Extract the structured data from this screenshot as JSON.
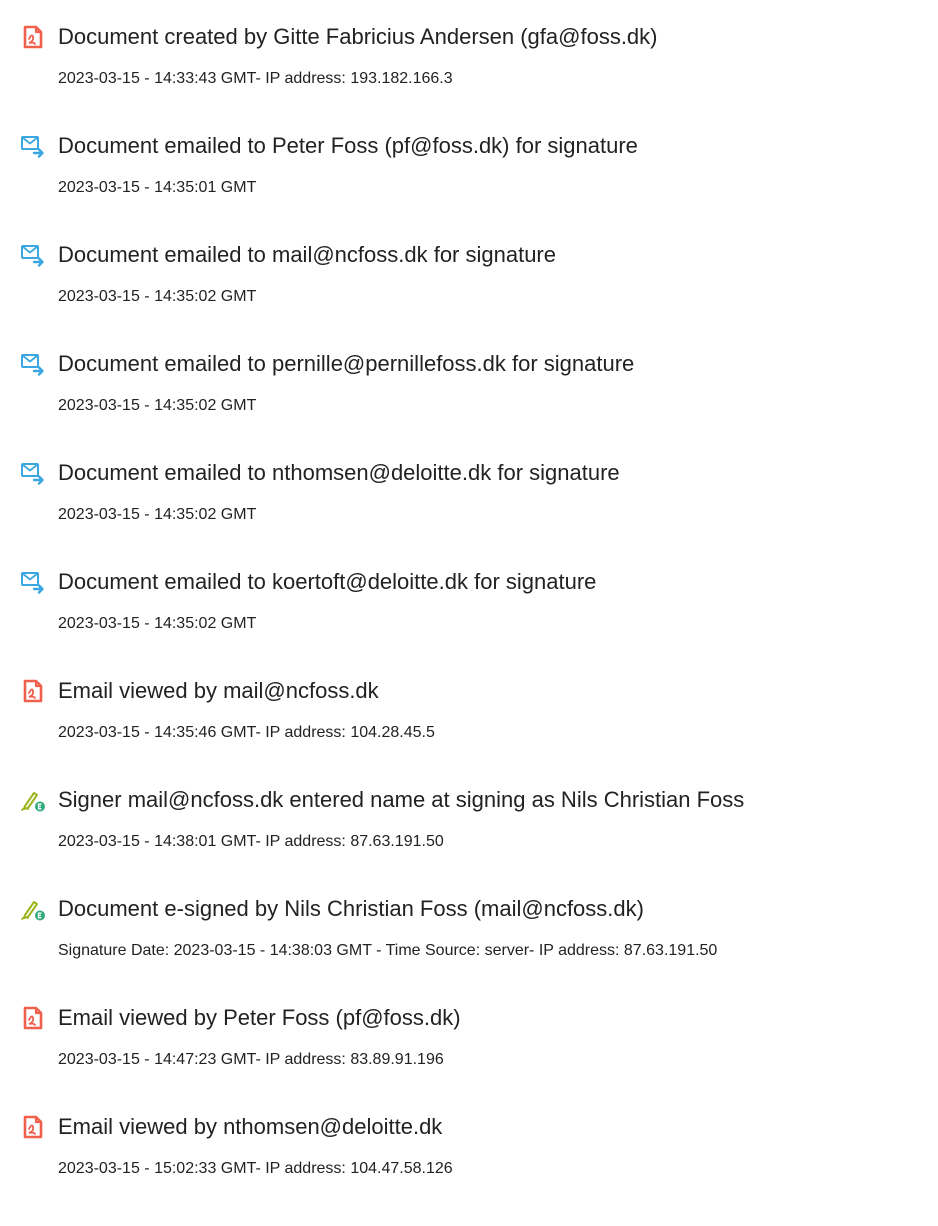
{
  "colors": {
    "text": "#222222",
    "doc_icon": "#f0614d",
    "email_icon": "#3aa7e0",
    "sign_icon_pen": "#9bb51c",
    "sign_icon_badge": "#2fa87a"
  },
  "events": [
    {
      "icon": "document-icon",
      "title": "Document created by Gitte Fabricius Andersen (gfa@foss.dk)",
      "detail": "2023-03-15 - 14:33:43 GMT- IP address: 193.182.166.3"
    },
    {
      "icon": "email-forward-icon",
      "title": "Document emailed to Peter Foss (pf@foss.dk) for signature",
      "detail": "2023-03-15 - 14:35:01 GMT"
    },
    {
      "icon": "email-forward-icon",
      "title": "Document emailed to mail@ncfoss.dk for signature",
      "detail": "2023-03-15 - 14:35:02 GMT"
    },
    {
      "icon": "email-forward-icon",
      "title": "Document emailed to pernille@pernillefoss.dk for signature",
      "detail": "2023-03-15 - 14:35:02 GMT"
    },
    {
      "icon": "email-forward-icon",
      "title": "Document emailed to nthomsen@deloitte.dk for signature",
      "detail": "2023-03-15 - 14:35:02 GMT"
    },
    {
      "icon": "email-forward-icon",
      "title": "Document emailed to koertoft@deloitte.dk for signature",
      "detail": "2023-03-15 - 14:35:02 GMT"
    },
    {
      "icon": "document-icon",
      "title": "Email viewed by mail@ncfoss.dk",
      "detail": "2023-03-15 - 14:35:46 GMT- IP address: 104.28.45.5"
    },
    {
      "icon": "e-sign-pen-icon",
      "title": "Signer mail@ncfoss.dk entered name at signing as Nils Christian Foss",
      "detail": "2023-03-15 - 14:38:01 GMT- IP address: 87.63.191.50"
    },
    {
      "icon": "e-sign-pen-icon",
      "title": "Document e-signed by Nils Christian Foss (mail@ncfoss.dk)",
      "detail": "Signature Date: 2023-03-15 - 14:38:03 GMT - Time Source: server- IP address: 87.63.191.50"
    },
    {
      "icon": "document-icon",
      "title": "Email viewed by Peter Foss (pf@foss.dk)",
      "detail": "2023-03-15 - 14:47:23 GMT- IP address: 83.89.91.196"
    },
    {
      "icon": "document-icon",
      "title": "Email viewed by nthomsen@deloitte.dk",
      "detail": "2023-03-15 - 15:02:33 GMT- IP address: 104.47.58.126"
    }
  ]
}
